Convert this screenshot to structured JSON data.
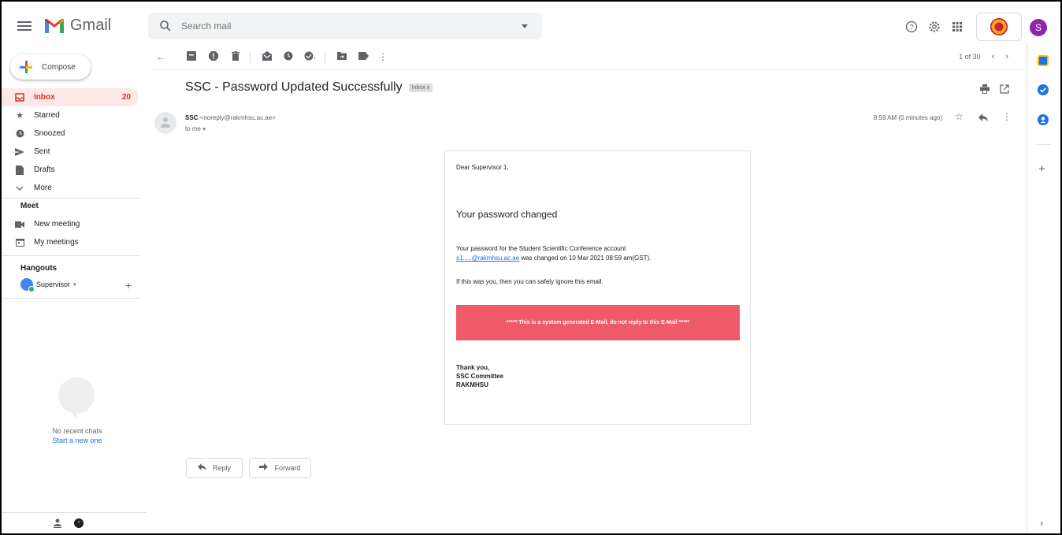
{
  "app": {
    "name": "Gmail"
  },
  "search": {
    "placeholder": "Search mail"
  },
  "user": {
    "avatar_letter": "S"
  },
  "compose": {
    "label": "Compose"
  },
  "nav": [
    {
      "label": "Inbox",
      "icon": "inbox-icon",
      "count": "20",
      "active": true
    },
    {
      "label": "Starred",
      "icon": "star-icon"
    },
    {
      "label": "Snoozed",
      "icon": "clock-icon"
    },
    {
      "label": "Sent",
      "icon": "send-icon"
    },
    {
      "label": "Drafts",
      "icon": "draft-icon"
    },
    {
      "label": "More",
      "icon": "chevron-down-icon"
    }
  ],
  "meet": {
    "title": "Meet",
    "items": [
      {
        "label": "New meeting",
        "icon": "video-icon"
      },
      {
        "label": "My meetings",
        "icon": "calendar-icon"
      }
    ]
  },
  "hangouts": {
    "title": "Hangouts",
    "user": "Supervisor",
    "no_chats": "No recent chats",
    "start_new": "Start a new one"
  },
  "pager": {
    "text": "1 of 30"
  },
  "message": {
    "subject": "SSC - Password Updated Successfully",
    "label_tag": "Inbox x",
    "sender_name": "SSC",
    "sender_email": "<noreply@rakmhsu.ac.ae>",
    "to": "to me",
    "time": "8:59 AM (0 minutes ago)"
  },
  "email_body": {
    "greeting": "Dear Supervisor 1,",
    "headline": "Your password changed",
    "para1_before": "Your password for the Student Scientific Conference account",
    "para1_link": "s1.....@rakmhsu.ac.ae",
    "para1_after": " was changed on 10 Mar 2021 08:59 am(GST).",
    "para2": "If this was you, then you can safely ignore this email.",
    "banner": "***** This is a system generated E-Mail, do not reply to this E-Mail *****",
    "sign1": "Thank you,",
    "sign2": "SSC Committee",
    "sign3": "RAKMHSU"
  },
  "actions": {
    "reply": "Reply",
    "forward": "Forward"
  },
  "colors": {
    "accent": "#d93025",
    "banner": "#ef5a6a",
    "link": "#1a73e8",
    "avatar": "#8e24aa"
  }
}
